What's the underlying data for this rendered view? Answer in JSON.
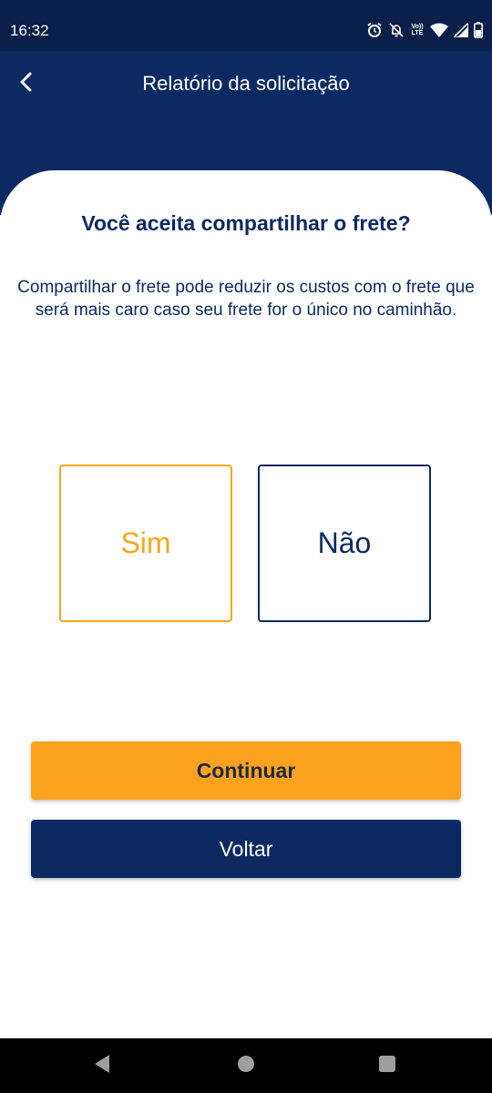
{
  "status_bar": {
    "time": "16:32",
    "volte_top": "Vo))",
    "volte_bottom": "LTE",
    "icons": [
      "alarm-icon",
      "notifications-off-icon",
      "volte-icon",
      "wifi-icon",
      "signal-icon",
      "battery-icon"
    ]
  },
  "header": {
    "title": "Relatório da solicitação",
    "back_icon": "chevron-left-icon"
  },
  "content": {
    "question": "Você aceita compartilhar o frete?",
    "description": "Compartilhar o frete pode reduzir os custos com o frete que será mais caro caso seu frete for o único no caminhão."
  },
  "options": {
    "yes_label": "Sim",
    "no_label": "Não",
    "selected": "Sim"
  },
  "buttons": {
    "continue_label": "Continuar",
    "back_label": "Voltar"
  },
  "nav": {
    "icons": [
      "back-triangle-icon",
      "home-circle-icon",
      "recents-square-icon"
    ]
  },
  "colors": {
    "primary_navy": "#0c2a62",
    "status_bar": "#0a1f4a",
    "accent_orange": "#f7a61e",
    "button_orange": "#fba21f"
  }
}
